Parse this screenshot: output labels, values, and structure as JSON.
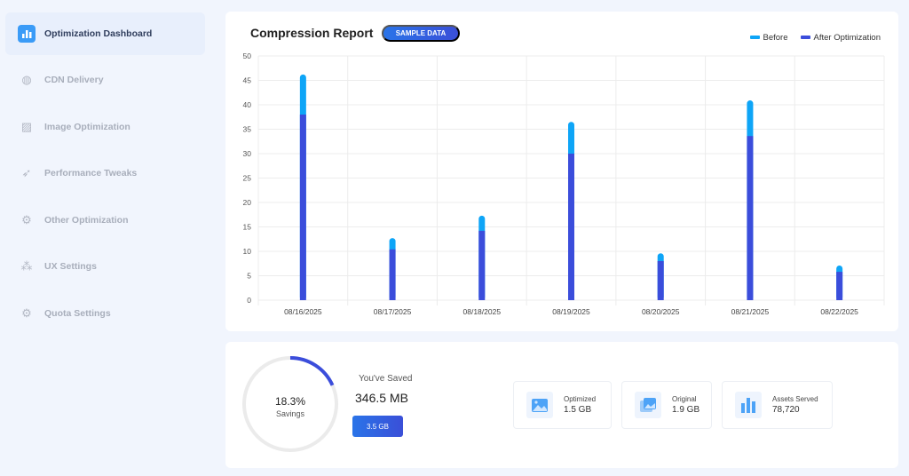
{
  "sidebar": {
    "items": [
      {
        "label": "Optimization Dashboard",
        "icon": "bar-chart-icon",
        "active": true
      },
      {
        "label": "CDN Delivery",
        "icon": "globe-icon"
      },
      {
        "label": "Image Optimization",
        "icon": "image-icon"
      },
      {
        "label": "Performance Tweaks",
        "icon": "rocket-icon"
      },
      {
        "label": "Other Optimization",
        "icon": "gear-icon"
      },
      {
        "label": "UX Settings",
        "icon": "nodes-icon"
      },
      {
        "label": "Quota Settings",
        "icon": "gear-icon"
      }
    ]
  },
  "report": {
    "title": "Compression Report",
    "badge": "SAMPLE DATA"
  },
  "chart_data": {
    "type": "bar",
    "categories": [
      "08/16/2025",
      "08/17/2025",
      "08/18/2025",
      "08/19/2025",
      "08/20/2025",
      "08/21/2025",
      "08/22/2025"
    ],
    "series": [
      {
        "name": "Before",
        "color": "#0ea5f7",
        "values": [
          46.2,
          12.7,
          17.3,
          36.5,
          9.6,
          40.9,
          7.1
        ]
      },
      {
        "name": "After Optimization",
        "color": "#3b4ddb",
        "values": [
          38,
          10.4,
          14.2,
          30,
          8,
          33.6,
          5.8
        ]
      }
    ],
    "ylim": [
      0,
      50
    ],
    "yticks": [
      0,
      5,
      10,
      15,
      20,
      25,
      30,
      35,
      40,
      45,
      50
    ],
    "grid": true,
    "legend": "top-right"
  },
  "summary": {
    "savings_percent": 18.3,
    "savings_pct_label": "18.3%",
    "savings_label": "Savings",
    "saved_label": "You've Saved",
    "saved_value": "346.5 MB",
    "total_button": "3.5 GB",
    "ring_color": "#3b4ddb",
    "stats": [
      {
        "label": "Optimized",
        "value": "1.5 GB",
        "icon": "image-icon"
      },
      {
        "label": "Original",
        "value": "1.9 GB",
        "icon": "images-icon"
      },
      {
        "label": "Assets Served",
        "value": "78,720",
        "icon": "bar-chart-icon"
      }
    ]
  }
}
